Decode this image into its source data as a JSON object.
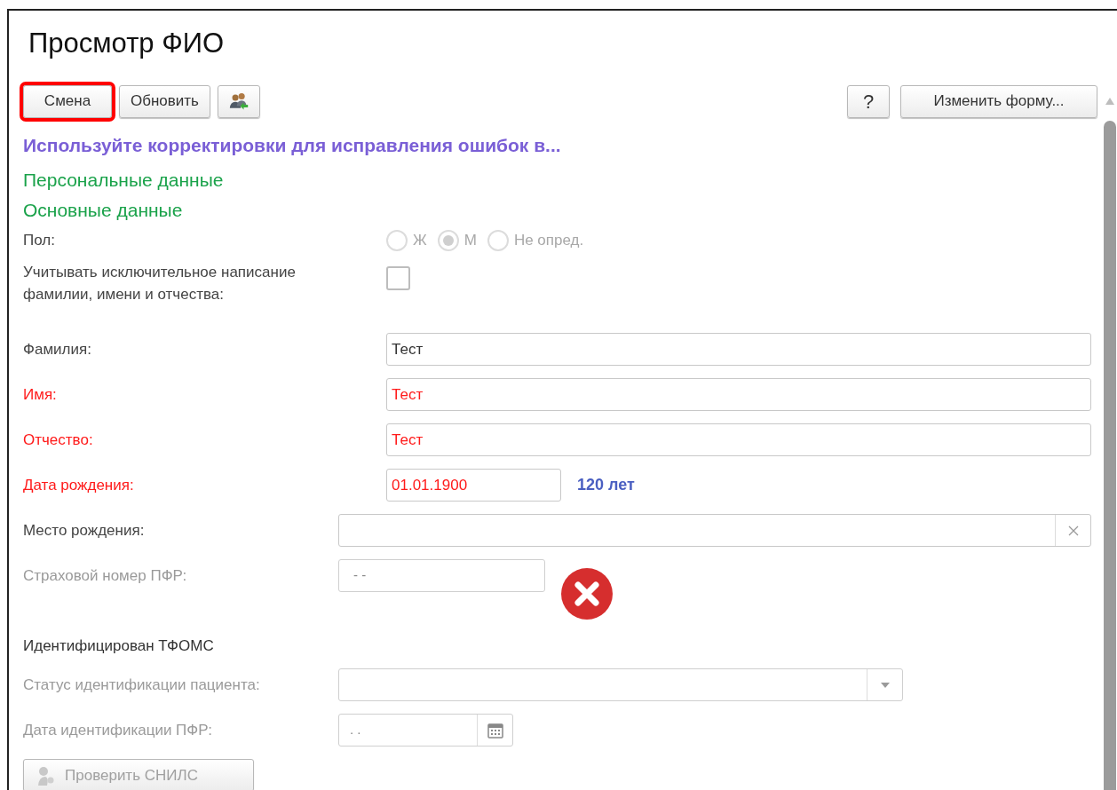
{
  "window": {
    "title": "Просмотр ФИО"
  },
  "toolbar": {
    "left": [
      {
        "kind": "text",
        "label": "Смена",
        "highlighted": true
      },
      {
        "kind": "text",
        "label": "Обновить",
        "highlighted": false
      },
      {
        "kind": "icon",
        "highlighted": false
      }
    ],
    "right": [
      {
        "label": "?"
      },
      {
        "label": "Изменить форму..."
      }
    ]
  },
  "notice": "Используйте корректировки для исправления ошибок в...",
  "sections": [
    "Персональные данные",
    "Основные данные"
  ],
  "rows": [
    {
      "kind": "radio",
      "label": "Пол:",
      "options": [
        {
          "label": "Ж",
          "selected": false
        },
        {
          "label": "М",
          "selected": true
        },
        {
          "label": "Не опред.",
          "selected": false
        }
      ]
    },
    {
      "kind": "checkbox",
      "label": "Учитывать исключительное написание фамилии, имени и отчества:",
      "checked": false
    },
    {
      "kind": "text",
      "label": "Фамилия:",
      "value": "Тест"
    },
    {
      "kind": "text",
      "label": "Имя:",
      "required": true,
      "value": "Тест"
    },
    {
      "kind": "text",
      "label": "Отчество:",
      "required": true,
      "value": "Тест"
    },
    {
      "kind": "date_age",
      "label": "Дата рождения:",
      "required": true,
      "value": "01.01.1900",
      "age": "120 лет"
    },
    {
      "kind": "clearable",
      "label": "Место рождения:"
    },
    {
      "kind": "snils",
      "label": "Страховой номер ПФР:",
      "disabled": true,
      "placeholder": "-  -"
    },
    {
      "kind": "heading",
      "label": "Идентифицирован ТФОМС"
    },
    {
      "kind": "select",
      "label": "Статус идентификации пациента:",
      "disabled": true
    },
    {
      "kind": "datepicker",
      "label": "Дата идентификации ПФР:",
      "disabled": true,
      "placeholder": ". ."
    },
    {
      "kind": "button",
      "label": "Проверить СНИЛС",
      "disabled": true
    }
  ]
}
